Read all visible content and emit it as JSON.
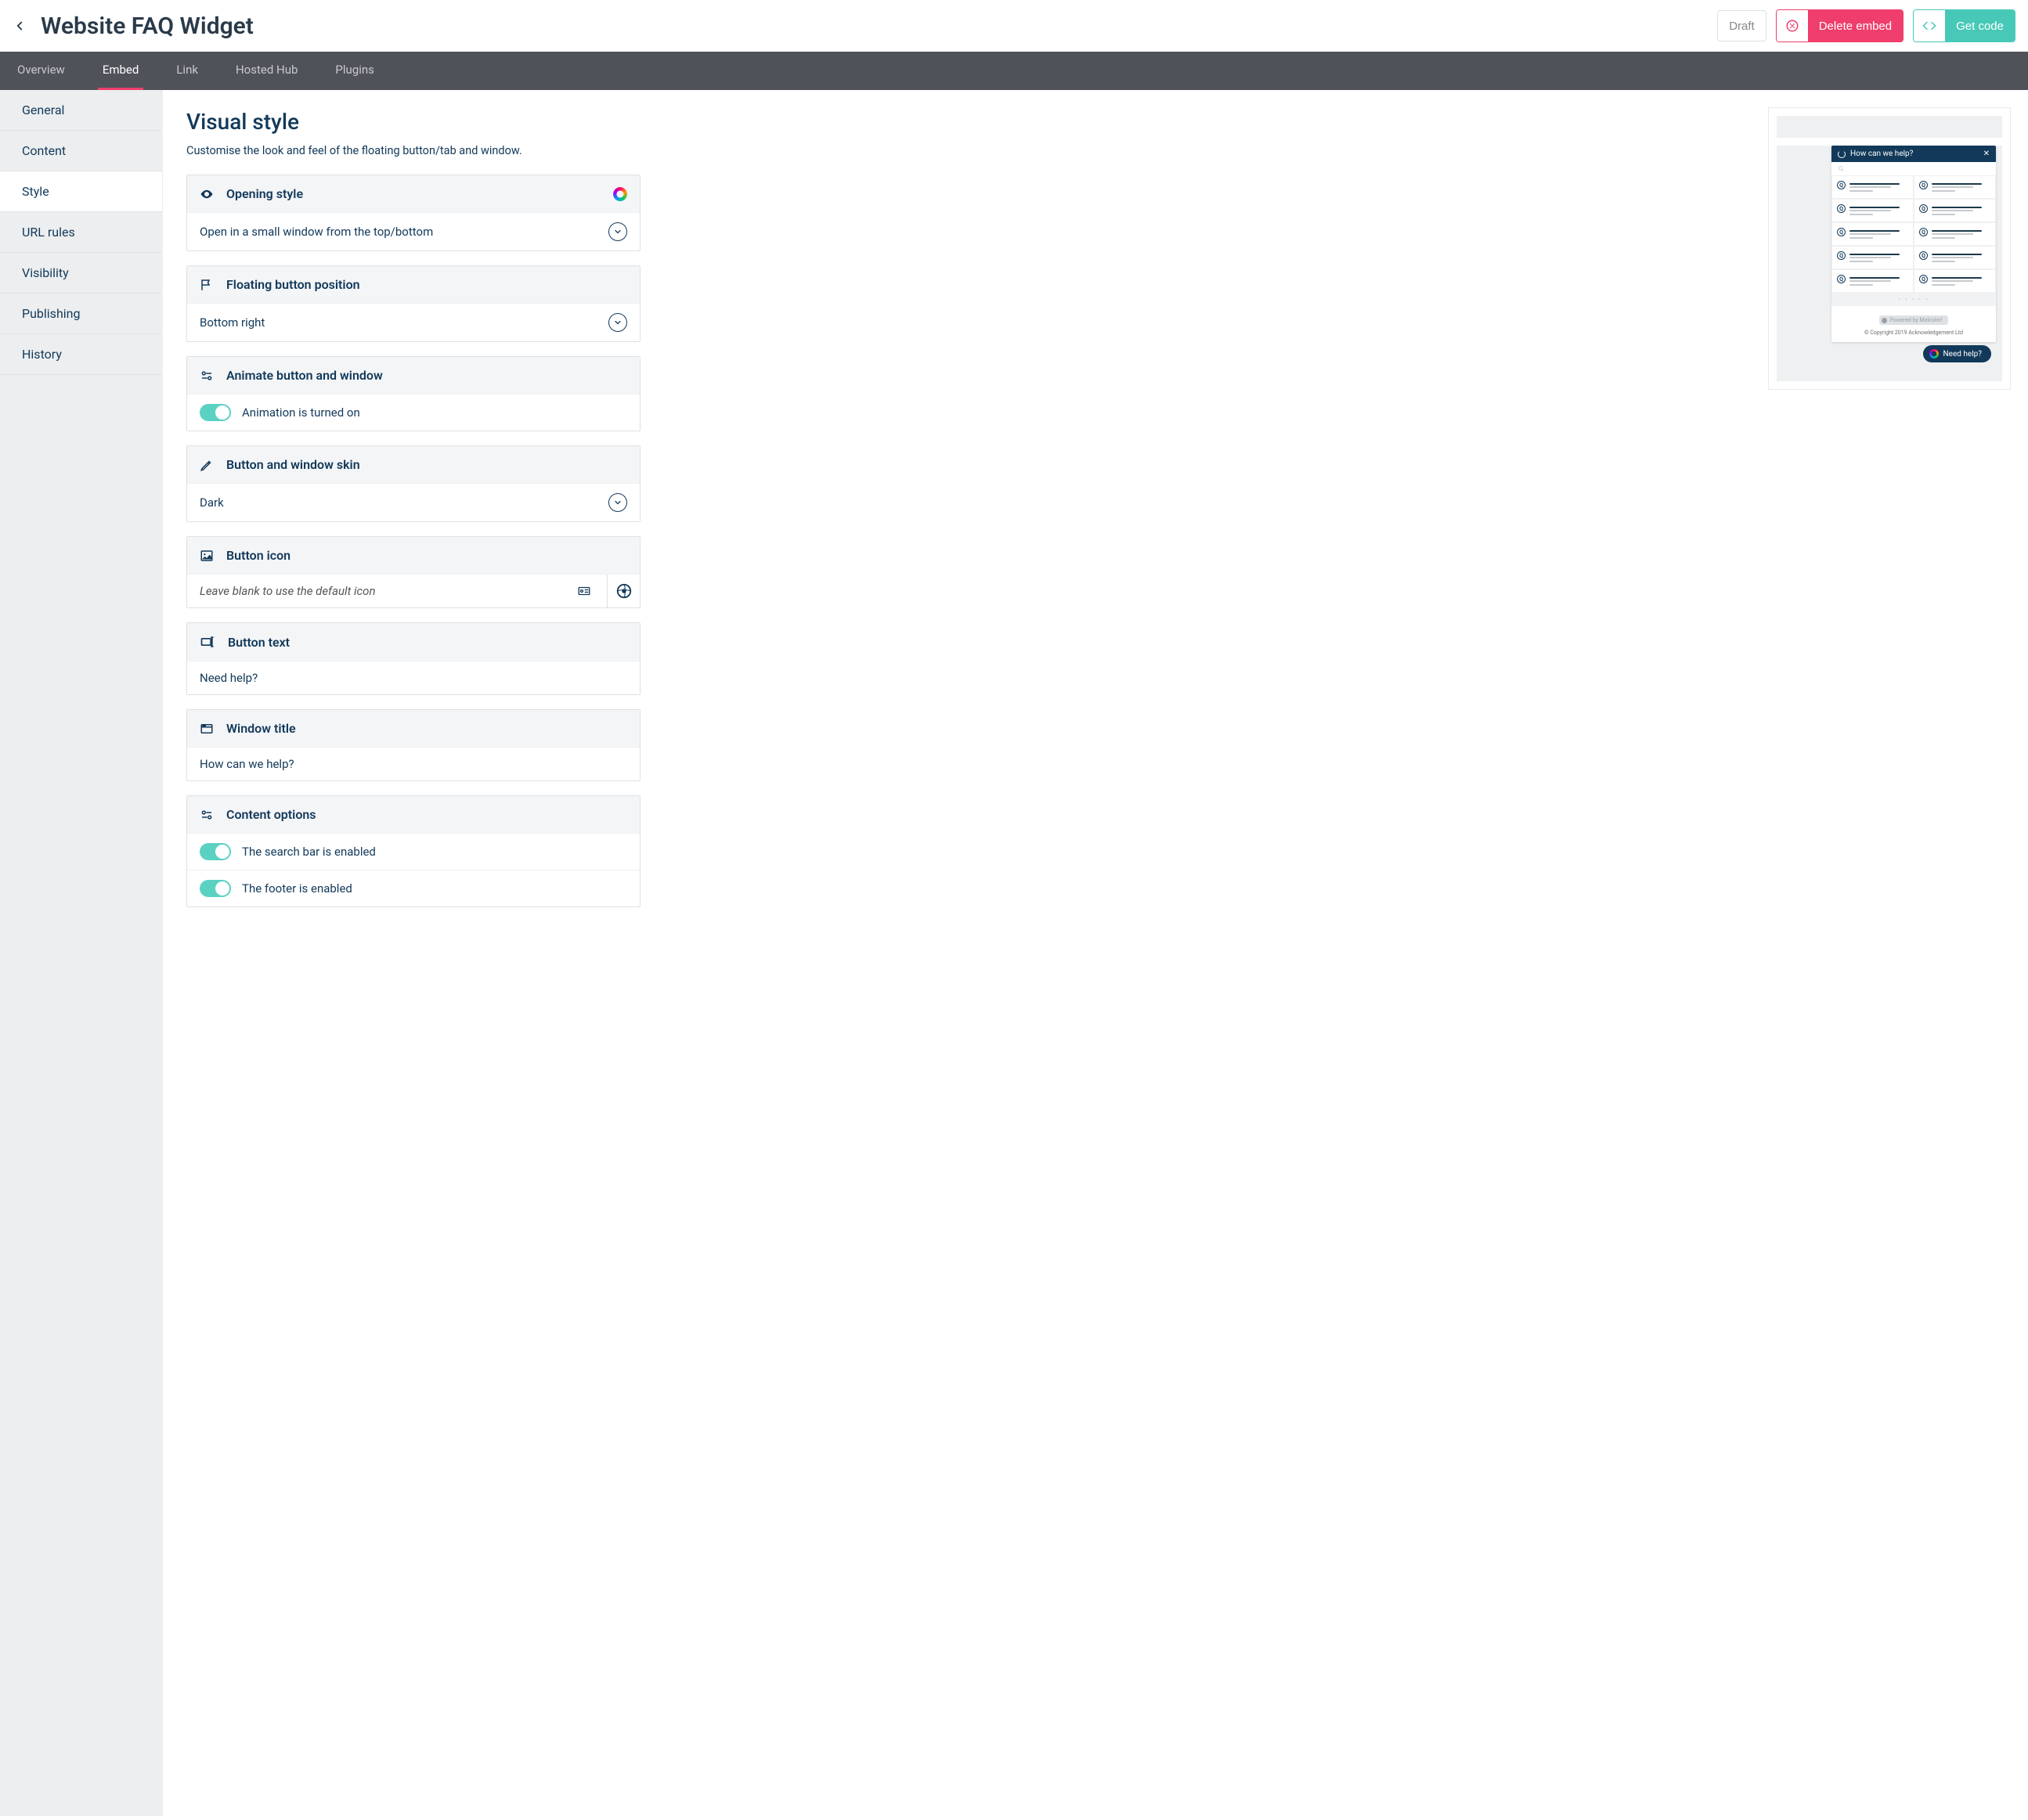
{
  "header": {
    "title": "Website FAQ Widget",
    "draft_label": "Draft",
    "delete_label": "Delete embed",
    "code_label": "Get code"
  },
  "tabs": [
    "Overview",
    "Embed",
    "Link",
    "Hosted Hub",
    "Plugins"
  ],
  "active_tab": "Embed",
  "sidebar": [
    "General",
    "Content",
    "Style",
    "URL rules",
    "Visibility",
    "Publishing",
    "History"
  ],
  "active_sidebar": "Style",
  "section": {
    "title": "Visual style",
    "desc": "Customise the look and feel of the floating button/tab and window."
  },
  "settings": {
    "opening_style": {
      "label": "Opening style",
      "value": "Open in a small window from the top/bottom"
    },
    "float_pos": {
      "label": "Floating button position",
      "value": "Bottom right"
    },
    "animate": {
      "label": "Animate button and window",
      "status": "Animation is turned on"
    },
    "skin": {
      "label": "Button and window skin",
      "value": "Dark"
    },
    "icon": {
      "label": "Button icon",
      "placeholder": "Leave blank to use the default icon"
    },
    "button_text": {
      "label": "Button text",
      "value": "Need help?"
    },
    "window_title": {
      "label": "Window title",
      "value": "How can we help?"
    },
    "content_opts": {
      "label": "Content options",
      "search": "The search bar is enabled",
      "footer": "The footer is enabled"
    }
  },
  "preview": {
    "header": "How can we help?",
    "powered": "Powered by Malcolm!",
    "copyright": "© Copyright 2019 Acknowledgement Ltd",
    "float_text": "Need help?",
    "q_glyph": "Q"
  }
}
